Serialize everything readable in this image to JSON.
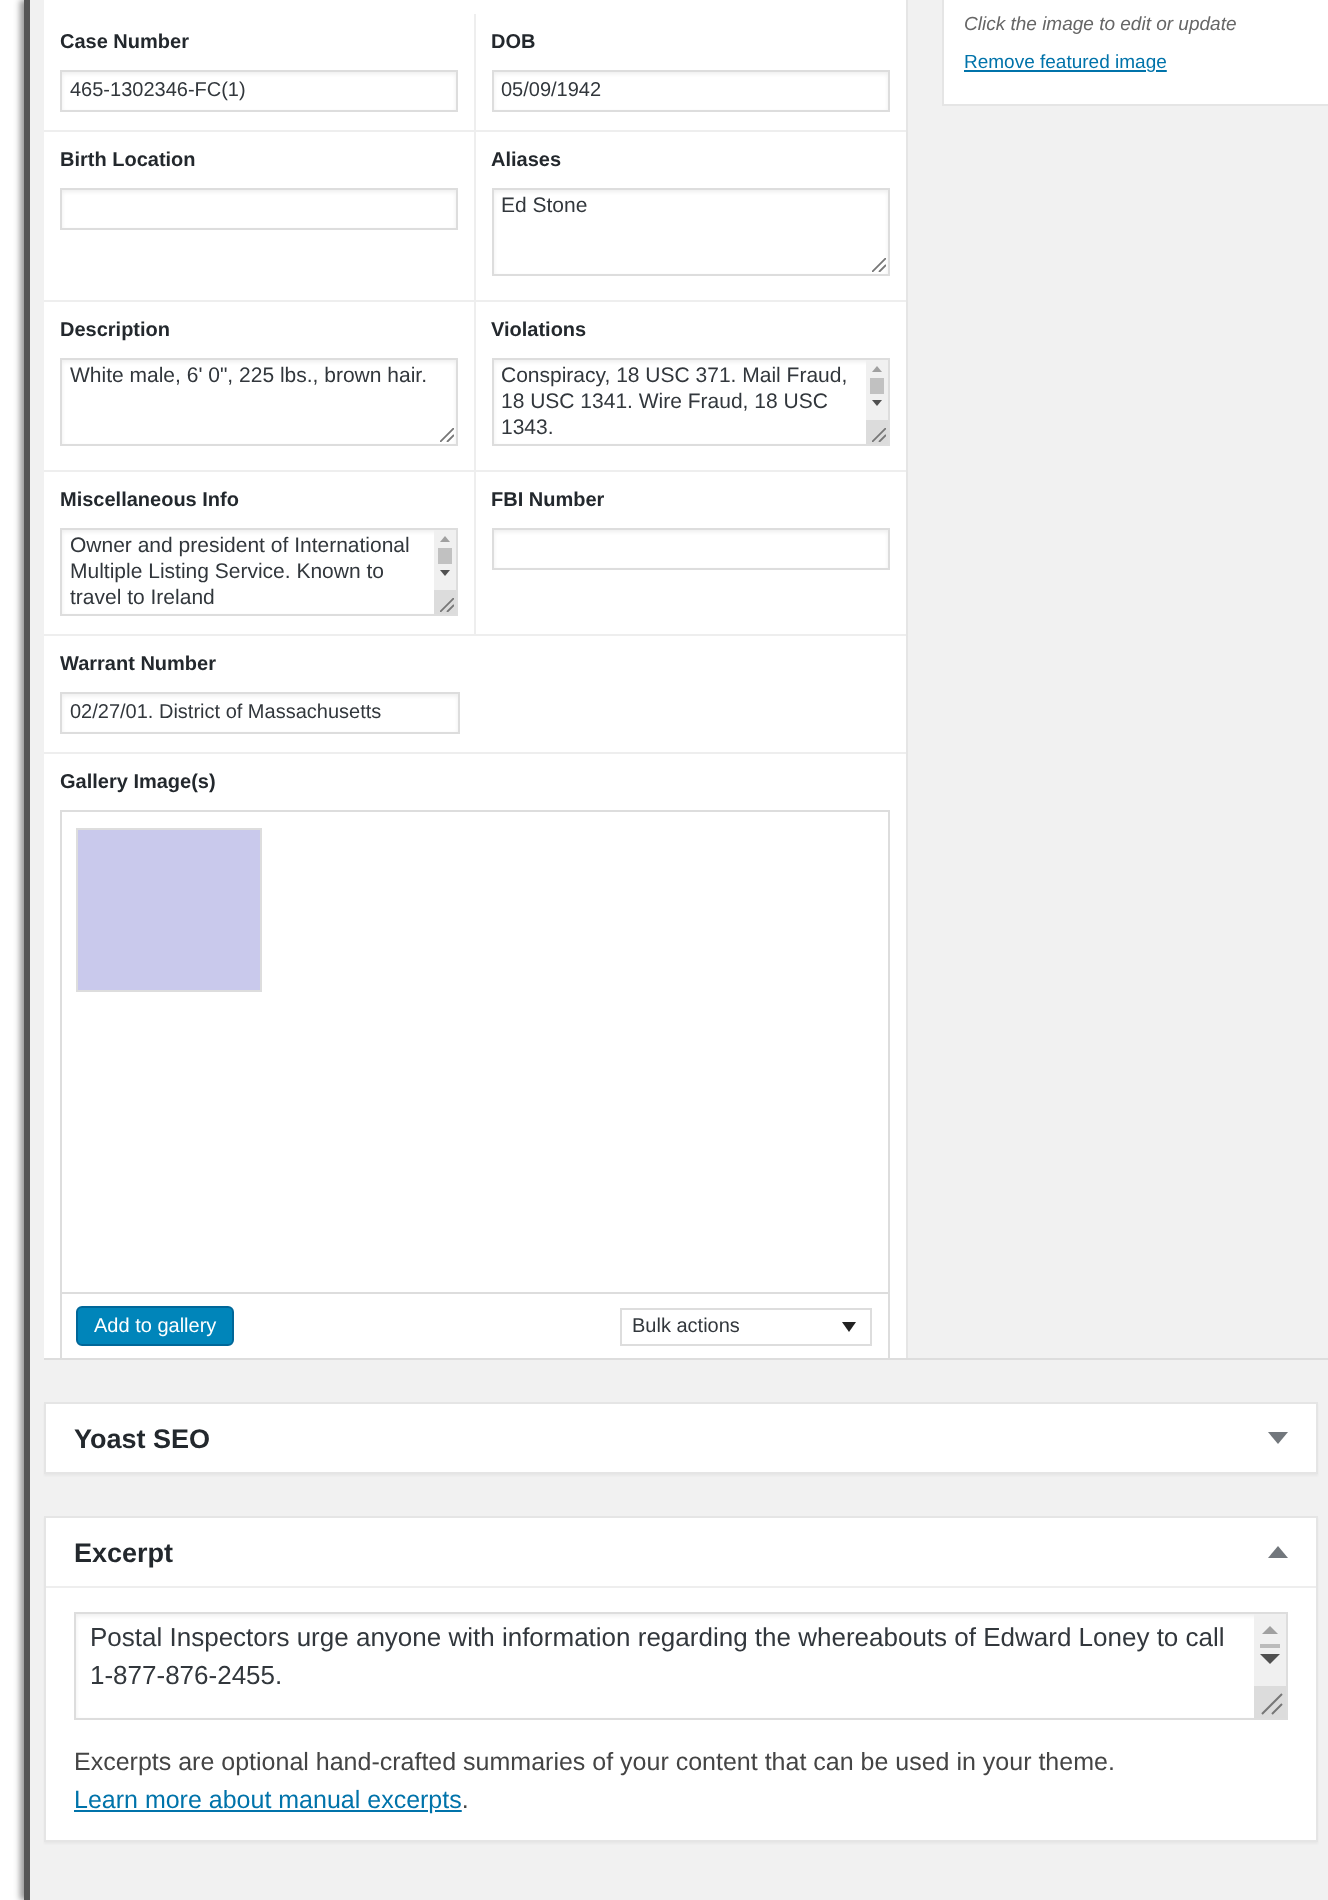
{
  "form_rows": [
    [
      {
        "label": "Case Number",
        "kind": "input",
        "value": "465-1302346-FC(1)"
      },
      {
        "label": "DOB",
        "kind": "input",
        "value": "05/09/1942"
      }
    ],
    [
      {
        "label": "Birth Location",
        "kind": "input"
      },
      {
        "label": "Aliases",
        "kind": "textarea",
        "value": "Ed Stone"
      }
    ],
    [
      {
        "label": "Description",
        "kind": "textarea",
        "value": "White male, 6' 0\", 225 lbs., brown hair."
      },
      {
        "label": "Violations",
        "kind": "scroll-textarea",
        "value": "Conspiracy, 18 USC 371. Mail Fraud, 18 USC 1341. Wire Fraud, 18 USC 1343."
      }
    ],
    [
      {
        "label": "Miscellaneous Info",
        "kind": "scroll-textarea",
        "value": "Owner and president of International Multiple Listing Service. Known to travel to Ireland"
      },
      {
        "label": "FBI Number",
        "kind": "input"
      }
    ],
    [
      {
        "label": "Warrant Number",
        "kind": "input",
        "value": "02/27/01. District of Massachusetts"
      }
    ]
  ],
  "gallery": {
    "label": "Gallery Image(s)",
    "add_button": "Add to gallery",
    "bulk_select": "Bulk actions"
  },
  "sidebar": {
    "hint": "Click the image to edit or update",
    "remove_link": "Remove featured image"
  },
  "panels": [
    {
      "title": "Yoast SEO",
      "expanded": false
    },
    {
      "title": "Excerpt",
      "expanded": true,
      "textarea": "Postal Inspectors urge anyone with information regarding the whereabouts of Edward Loney to call 1-877-876-2455.",
      "help_before": "Excerpts are optional hand-crafted summaries of your content that can be used in your theme. ",
      "help_link": "Learn more about manual excerpts",
      "help_after": "."
    }
  ]
}
